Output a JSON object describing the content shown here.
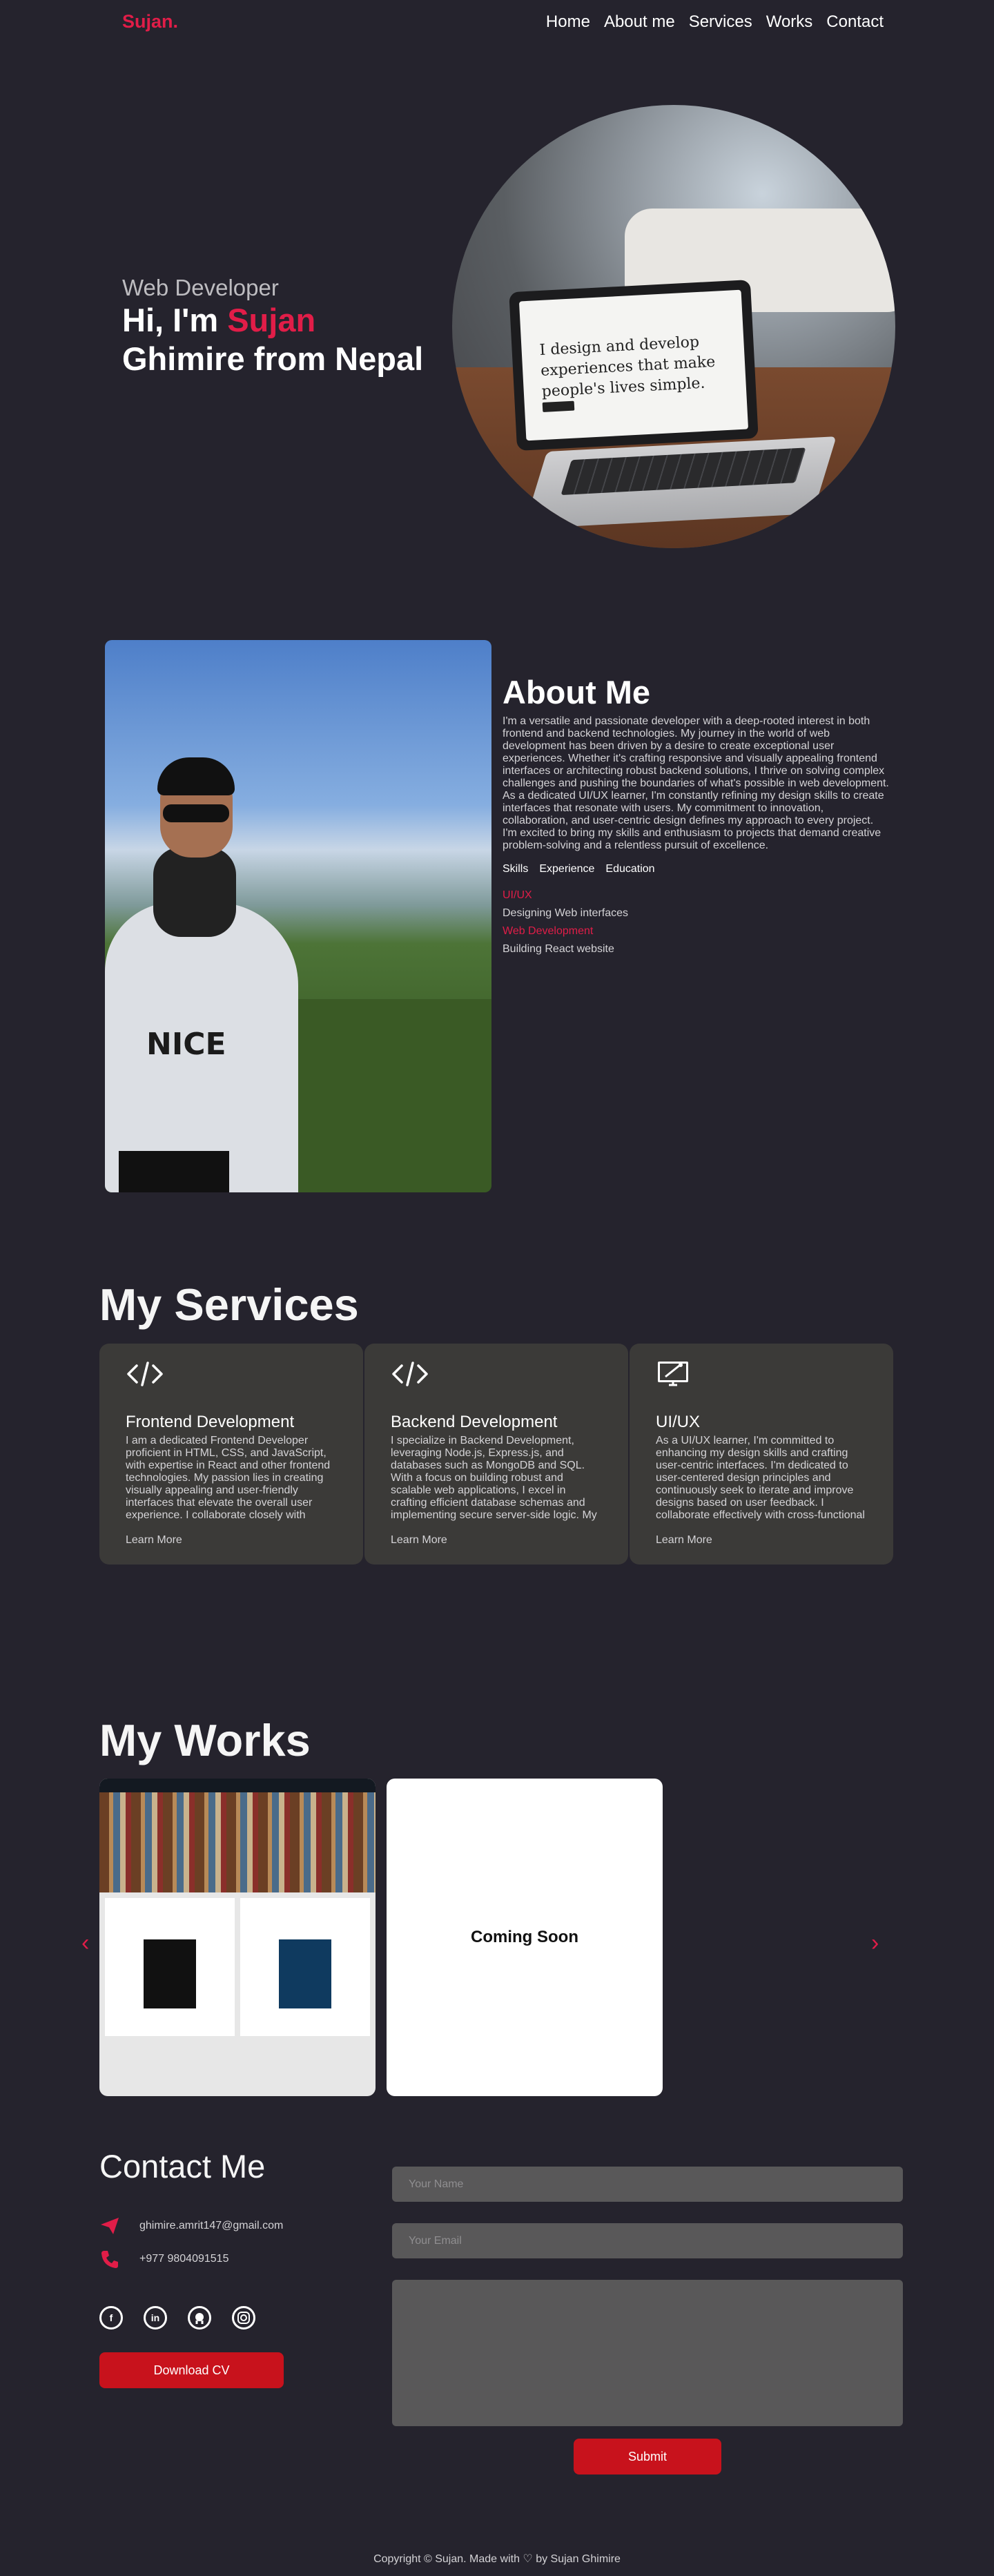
{
  "nav": {
    "logo": "Sujan.",
    "links": [
      "Home",
      "About me",
      "Services",
      "Works",
      "Contact"
    ]
  },
  "hero": {
    "subtitle": "Web Developer",
    "greeting": "Hi, I'm ",
    "name": "Sujan",
    "line2": "Ghimire from Nepal",
    "laptop_text": "I design and develop experiences that make people's lives simple."
  },
  "about": {
    "title": "About Me",
    "paragraph": "I'm a versatile and passionate developer with a deep-rooted interest in both frontend and backend technologies. My journey in the world of web development has been driven by a desire to create exceptional user experiences. Whether it's crafting responsive and visually appealing frontend interfaces or architecting robust backend solutions, I thrive on solving complex challenges and pushing the boundaries of what's possible in web development. As a dedicated UI/UX learner, I'm constantly refining my design skills to create interfaces that resonate with users. My commitment to innovation, collaboration, and user-centric design defines my approach to every project. I'm excited to bring my skills and enthusiasm to projects that demand creative problem-solving and a relentless pursuit of excellence.",
    "tabs": [
      "Skills",
      "Experience",
      "Education"
    ],
    "skills": [
      {
        "name": "UI/UX",
        "detail": "Designing Web interfaces"
      },
      {
        "name": "Web Development",
        "detail": "Building React website"
      }
    ],
    "hoodie_text": "NICE"
  },
  "services": {
    "title": "My Services",
    "cards": [
      {
        "icon": "code-icon",
        "title": "Frontend Development",
        "desc": "I am a dedicated Frontend Developer proficient in HTML, CSS, and JavaScript, with expertise in React and other frontend technologies. My passion lies in creating visually appealing and user-friendly interfaces that elevate the overall user experience. I collaborate closely with",
        "link": "Learn More"
      },
      {
        "icon": "code-icon",
        "title": "Backend Development",
        "desc": "I specialize in Backend Development, leveraging Node.js, Express.js, and databases such as MongoDB and SQL. With a focus on building robust and scalable web applications, I excel in crafting efficient database schemas and implementing secure server-side logic. My",
        "link": "Learn More"
      },
      {
        "icon": "design-monitor-icon",
        "title": "UI/UX",
        "desc": "As a UI/UX learner, I'm committed to enhancing my design skills and crafting user-centric interfaces. I'm dedicated to user-centered design principles and continuously seek to iterate and improve designs based on user feedback. I collaborate effectively with cross-functional",
        "link": "Learn More"
      }
    ]
  },
  "works": {
    "title": "My Works",
    "prev": "‹",
    "next": "›",
    "coming_soon": "Coming Soon"
  },
  "contact": {
    "title": "Contact Me",
    "email": "ghimire.amrit147@gmail.com",
    "phone": "+977 9804091515",
    "socials": [
      "facebook-icon",
      "linkedin-icon",
      "github-icon",
      "instagram-icon"
    ],
    "download_cv": "Download CV",
    "name_placeholder": "Your Name",
    "email_placeholder": "Your Email",
    "submit": "Submit"
  },
  "footer": {
    "text": "Copyright © Sujan. Made with ♡ by Sujan Ghimire"
  }
}
